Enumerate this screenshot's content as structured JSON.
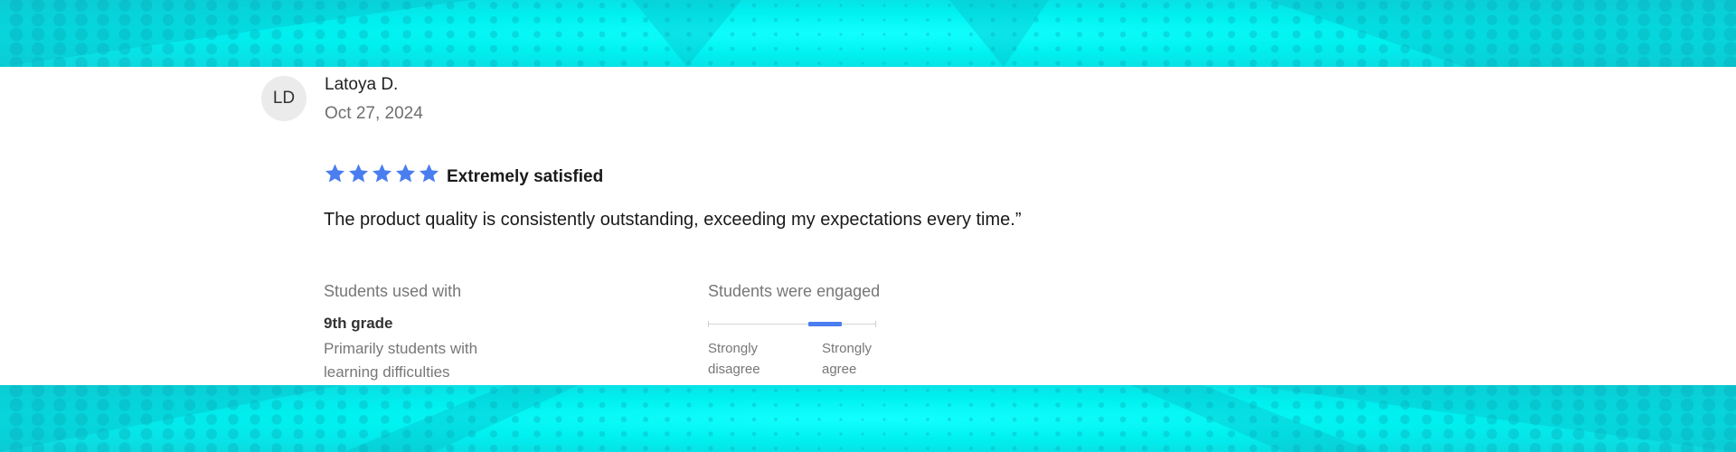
{
  "review": {
    "avatar_initials": "LD",
    "reviewer_name": "Latoya D.",
    "date": "Oct 27, 2024",
    "rating": 5,
    "rating_max": 5,
    "star_color": "#4a7ef0",
    "rating_label": "Extremely satisfied",
    "text": "The product quality is consistently outstanding, exceeding my expectations every time.”"
  },
  "students_used_with": {
    "heading": "Students used with",
    "grade": "9th grade",
    "description": "Primarily students with learning difficulties"
  },
  "students_engaged": {
    "heading": "Students were engaged",
    "scale_low_label": "Strongly disagree",
    "scale_high_label": "Strongly agree",
    "scale_steps": 5,
    "selected_step": 4,
    "fill_color": "#4a7ef0"
  },
  "banner": {
    "base_color": "#00f2f2",
    "dot_color": "#10c0c8"
  }
}
